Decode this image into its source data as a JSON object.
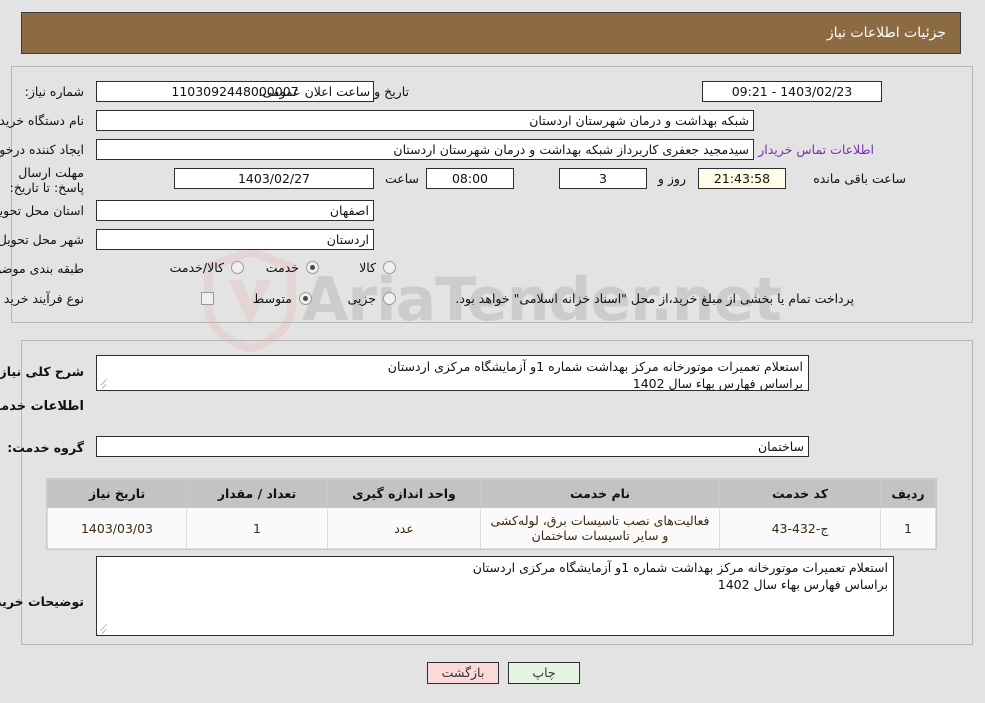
{
  "header": {
    "title": "جزئیات اطلاعات نیاز",
    "bar_color": "#8c6b43"
  },
  "watermark": {
    "text": "AriaTender.net"
  },
  "top_form": {
    "need_number_label": "شماره نیاز:",
    "need_number_value": "1103092448000007",
    "buyer_org_label": "نام دستگاه خریدار:",
    "buyer_org_value": "شبکه بهداشت و درمان شهرستان اردستان",
    "creator_label": "ایجاد کننده درخواست:",
    "creator_value": "سیدمجید جعفری کاربرداز شبکه بهداشت و درمان شهرستان اردستان",
    "contact_link": "اطلاعات تماس خریدار",
    "deadline_label": "مهلت ارسال پاسخ: تا تاریخ:",
    "deadline_date": "1403/02/27",
    "hour_label": "ساعت",
    "deadline_time": "08:00",
    "days_value": "3",
    "days_label": "روز و",
    "countdown_value": "21:43:58",
    "countdown_label": "ساعت باقی مانده",
    "province_label": "استان محل تحویل:",
    "province_value": "اصفهان",
    "city_label": "شهر محل تحویل:",
    "city_value": "اردستان",
    "category_label": "طبقه بندی موضوعی:",
    "category_options": [
      {
        "label": "کالا",
        "selected": false
      },
      {
        "label": "خدمت",
        "selected": true
      },
      {
        "label": "کالا/خدمت",
        "selected": false
      }
    ],
    "process_label": "نوع فرآیند خرید :",
    "process_options": [
      {
        "label": "جزیی",
        "selected": false
      },
      {
        "label": "متوسط",
        "selected": true
      }
    ],
    "treasury_checkbox_checked": false,
    "treasury_text": "پرداخت تمام یا بخشی از مبلغ خرید،از محل \"اسناد خزانه اسلامی\" خواهد بود.",
    "announce_label": "تاریخ و ساعت اعلان عمومی:",
    "announce_value": "1403/02/23 - 09:21"
  },
  "summary": {
    "label": "شرح کلی نیاز:",
    "value": "استعلام تعمیرات موتورخانه مرکز بهداشت شماره  1و آزمایشگاه مرکزی اردستان\nبراساس فهارس بهاء سال 1402"
  },
  "services_section": {
    "heading": "اطلاعات خدمات مورد نیاز",
    "group_label": "گروه خدمت:",
    "group_value": "ساختمان"
  },
  "table": {
    "columns": [
      "ردیف",
      "کد خدمت",
      "نام خدمت",
      "واحد اندازه گیری",
      "تعداد / مقدار",
      "تاریخ نیاز"
    ],
    "rows": [
      {
        "row": "1",
        "code": "ج-432-43",
        "name": "فعالیت‌های نصب تاسیسات برق، لوله‌کشی و سایر تاسیسات ساختمان",
        "unit": "عدد",
        "qty": "1",
        "date": "1403/03/03"
      }
    ]
  },
  "buyer_notes": {
    "label": "توضیحات خریدار:",
    "value": "استعلام تعمیرات موتورخانه مرکز بهداشت شماره  1و آزمایشگاه مرکزی اردستان\nبراساس فهارس بهاء سال 1402"
  },
  "footer": {
    "print_label": "چاپ",
    "back_label": "بازگشت"
  }
}
